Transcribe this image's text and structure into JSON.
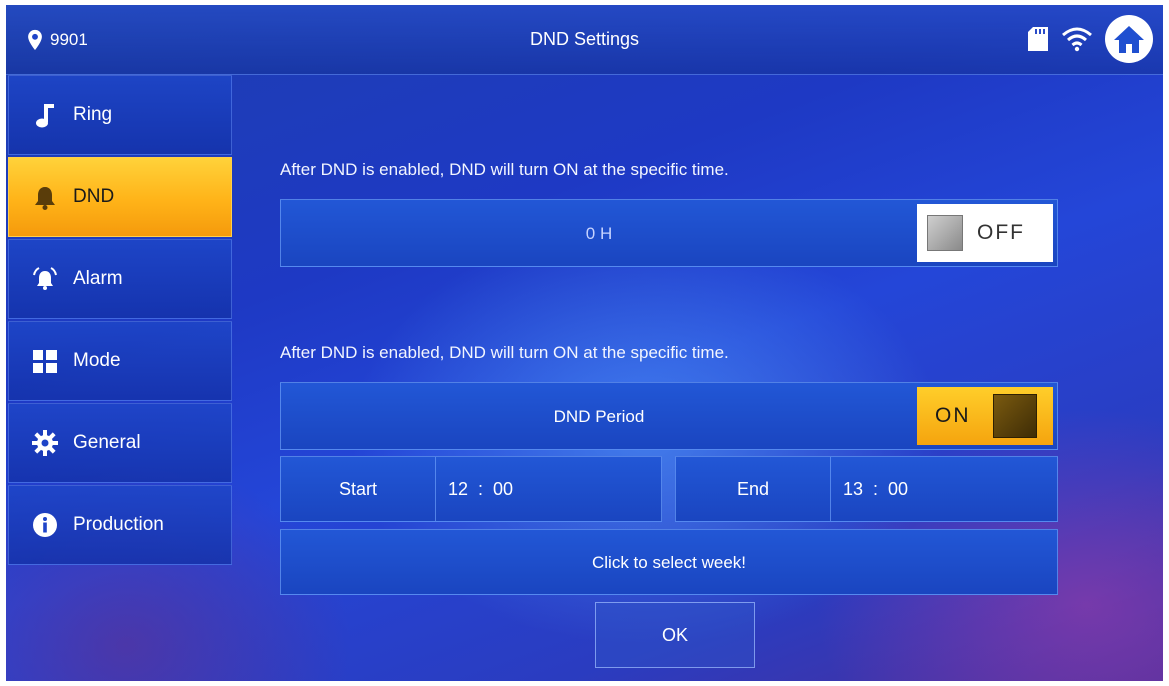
{
  "header": {
    "room_number": "9901",
    "title": "DND Settings",
    "status_icons": [
      "sd-card-icon",
      "wifi-icon"
    ],
    "home_icon": "home-icon"
  },
  "sidebar": {
    "items": [
      {
        "label": "Ring",
        "icon": "music-note-icon",
        "active": false
      },
      {
        "label": "DND",
        "icon": "bell-icon",
        "active": true
      },
      {
        "label": "Alarm",
        "icon": "alarm-icon",
        "active": false
      },
      {
        "label": "Mode",
        "icon": "grid-icon",
        "active": false
      },
      {
        "label": "General",
        "icon": "gear-icon",
        "active": false
      },
      {
        "label": "Production",
        "icon": "info-icon",
        "active": false
      }
    ]
  },
  "main": {
    "section1": {
      "hint": "After DND is enabled, DND will turn ON at the specific time.",
      "value": "0 H",
      "toggle_label": "OFF",
      "toggle_state": "off"
    },
    "section2": {
      "hint": "After DND is enabled, DND will turn ON at the specific time.",
      "label": "DND Period",
      "toggle_label": "ON",
      "toggle_state": "on"
    },
    "start": {
      "label": "Start",
      "hour": "12",
      "separator": ":",
      "minute": "00"
    },
    "end": {
      "label": "End",
      "hour": "13",
      "separator": ":",
      "minute": "00"
    },
    "week_button": "Click to select week!",
    "ok_button": "OK"
  },
  "colors": {
    "accent": "#ffb318",
    "background": "#1e39c4",
    "bar": "#2257d6"
  }
}
